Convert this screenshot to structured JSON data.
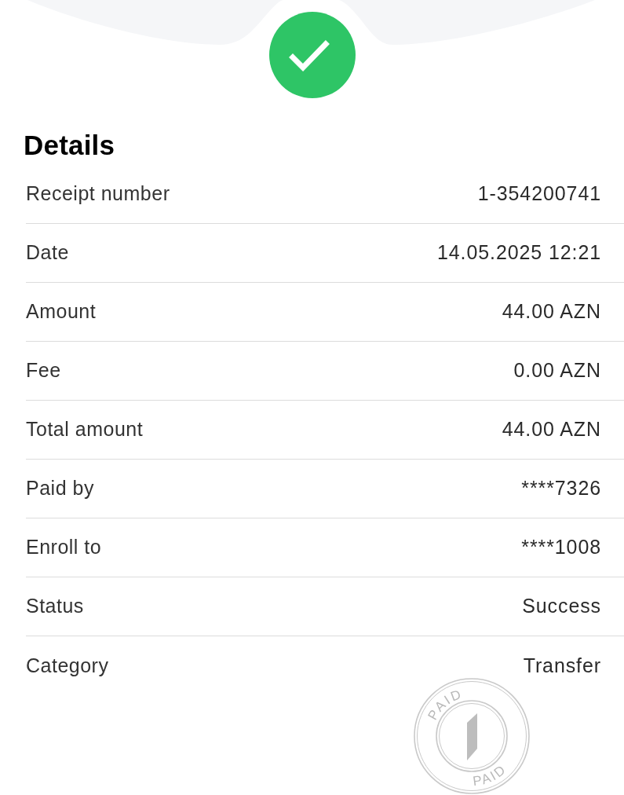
{
  "heading": "Details",
  "details": [
    {
      "label": "Receipt number",
      "value": "1-354200741"
    },
    {
      "label": "Date",
      "value": "14.05.2025 12:21"
    },
    {
      "label": "Amount",
      "value": "44.00 AZN"
    },
    {
      "label": "Fee",
      "value": "0.00 AZN"
    },
    {
      "label": "Total amount",
      "value": "44.00 AZN"
    },
    {
      "label": "Paid by",
      "value": "****7326"
    },
    {
      "label": "Enroll to",
      "value": "****1008"
    },
    {
      "label": "Status",
      "value": "Success"
    },
    {
      "label": "Category",
      "value": "Transfer"
    }
  ],
  "stamp": {
    "top_text": "PAID",
    "bottom_text": "PAID"
  }
}
